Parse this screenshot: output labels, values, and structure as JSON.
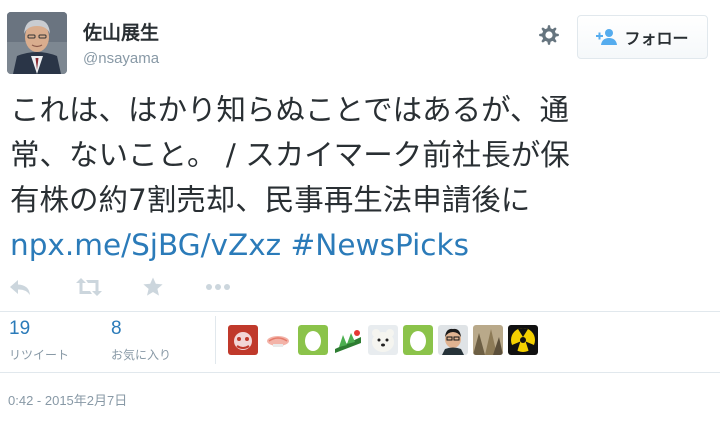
{
  "user": {
    "name": "佐山展生",
    "handle": "@nsayama"
  },
  "follow_button": {
    "label": "フォロー"
  },
  "tweet": {
    "lines": [
      "これは、はかり知らぬことではあるが、通",
      "常、ないこと。 / スカイマーク前社長が保",
      "有株の約7割売却、民事再生法申請後に"
    ],
    "link": "npx.me/SjBG/vZxz",
    "hashtag": "#NewsPicks"
  },
  "icons": {
    "reply": "reply-icon",
    "retweet": "retweet-icon",
    "favorite": "star-icon",
    "more": "more-icon",
    "settings": "gear-icon",
    "follow": "add-user-icon"
  },
  "stats": {
    "retweets": {
      "count": "19",
      "label": "リツイート"
    },
    "favorites": {
      "count": "8",
      "label": "お気に入り"
    }
  },
  "timestamp": "0:42 - 2015年2月7日",
  "colors": {
    "link": "#2b7bb9",
    "muted": "#8899a6",
    "text": "#292f33",
    "border": "#e1e8ed"
  }
}
